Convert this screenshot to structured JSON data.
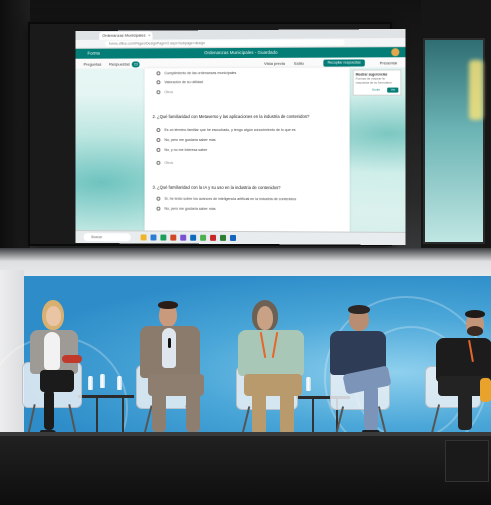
{
  "browser": {
    "tab_label": "Ordenanzas Municipales",
    "address": "forms.office.com/Pages/DesignPageV2.aspx?subpage=design",
    "app_name": "Forms",
    "doc_title": "Ordenanzas Municipales - Guardado",
    "present_label": "Presentar",
    "cmd_preview": "Vista previa",
    "cmd_style": "Estilo",
    "cmd_collect": "Recopilar respuestas",
    "cmd_questions": "Preguntas",
    "cmd_responses": "Respuestas",
    "responses_count": "23"
  },
  "form": {
    "q1_options": [
      "Cumplimiento de las ordenanzas municipales",
      "Valoración de su utilidad",
      "Otros"
    ],
    "q2_title": "2. ¿Qué familiaridad con Metaverso y las aplicaciones en la industria de contenidos?",
    "q2_options": [
      "Es un término familiar que he escuchado, y tengo algún conocimiento de lo que es",
      "No, pero me gustaría saber más",
      "No, y no me interesa saber",
      "Otros"
    ],
    "q3_title": "3. ¿Qué familiaridad con la IA y su uso en la industria de contenidos?",
    "q3_options": [
      "Sí, he leído sobre los avances de inteligencia artificial en la industria de contenidos",
      "No, pero me gustaría saber más"
    ]
  },
  "panel": {
    "title": "Mostrar sugerencias",
    "body": "Formas de mejorar la respuesta de su formulario",
    "ok_label": "Ver",
    "cancel_label": "Omitir"
  },
  "taskbar": {
    "search_label": "Buscar"
  },
  "colors": {
    "forms_teal": "#037d76",
    "backdrop_blue": "#3a97cf",
    "lanyard_orange": "#e8652b"
  }
}
